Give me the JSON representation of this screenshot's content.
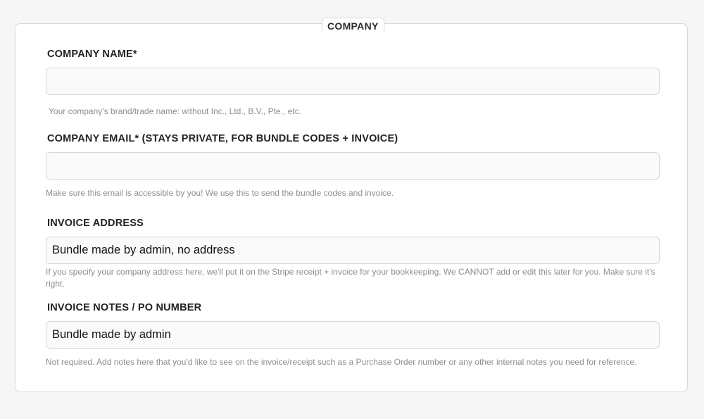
{
  "section": {
    "title": "COMPANY"
  },
  "fields": {
    "company_name": {
      "label": "COMPANY NAME*",
      "value": "",
      "help": "Your company's brand/trade name: without Inc., Ltd., B.V., Pte., etc."
    },
    "company_email": {
      "label": "COMPANY EMAIL* (STAYS PRIVATE, FOR BUNDLE CODES + INVOICE)",
      "value": "",
      "help": "Make sure this email is accessible by you! We use this to send the bundle codes and invoice."
    },
    "invoice_address": {
      "label": "INVOICE ADDRESS",
      "value": "Bundle made by admin, no address",
      "help": "If you specify your company address here, we'll put it on the Stripe receipt + invoice for your bookkeeping. We CANNOT add or edit this later for you. Make sure it's right."
    },
    "invoice_notes": {
      "label": "INVOICE NOTES / PO NUMBER",
      "value": "Bundle made by admin",
      "help": "Not required. Add notes here that you'd like to see on the invoice/receipt such as a Purchase Order number or any other internal notes you need for reference."
    }
  }
}
